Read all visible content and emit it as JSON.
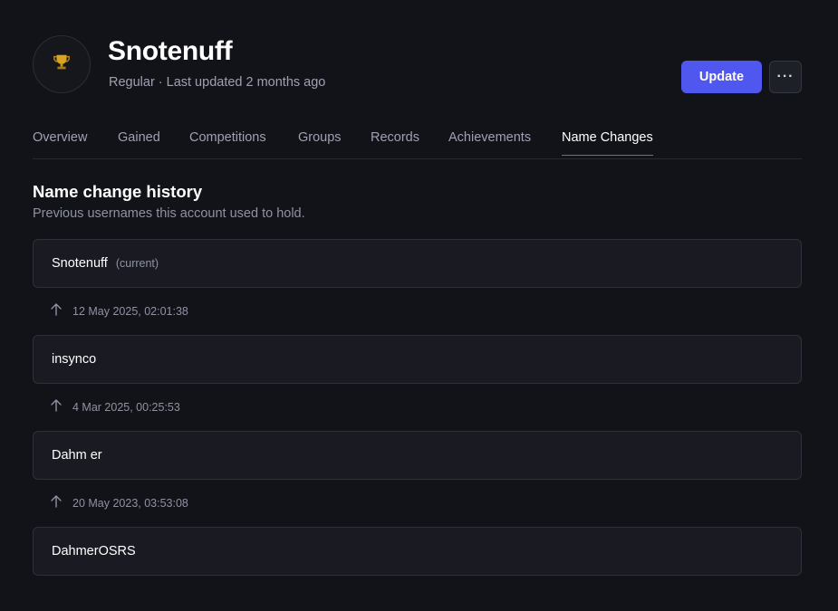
{
  "header": {
    "player_name": "Snotenuff",
    "account_type": "Regular",
    "separator": "·",
    "last_updated": "Last updated 2 months ago",
    "avatar_icon": "trophy-icon",
    "update_label": "Update",
    "more_label": "···",
    "accent_color": "#4f57ee"
  },
  "tabs": [
    {
      "label": "Overview"
    },
    {
      "label": "Gained"
    },
    {
      "label": "Competitions"
    },
    {
      "label": "Groups"
    },
    {
      "label": "Records"
    },
    {
      "label": "Achievements"
    },
    {
      "label": "Name Changes",
      "active": true
    }
  ],
  "section": {
    "title": "Name change history",
    "description": "Previous usernames this account used to hold."
  },
  "history": {
    "names": [
      {
        "name": "Snotenuff",
        "tag": "(current)"
      },
      {
        "name": "insynco"
      },
      {
        "name": "Dahm er"
      },
      {
        "name": "DahmerOSRS"
      }
    ],
    "changes": [
      {
        "date": "12 May 2025, 02:01:38",
        "icon": "arrow-up-icon"
      },
      {
        "date": "4 Mar 2025, 00:25:53",
        "icon": "arrow-up-icon"
      },
      {
        "date": "20 May 2023, 03:53:08",
        "icon": "arrow-up-icon"
      }
    ]
  }
}
